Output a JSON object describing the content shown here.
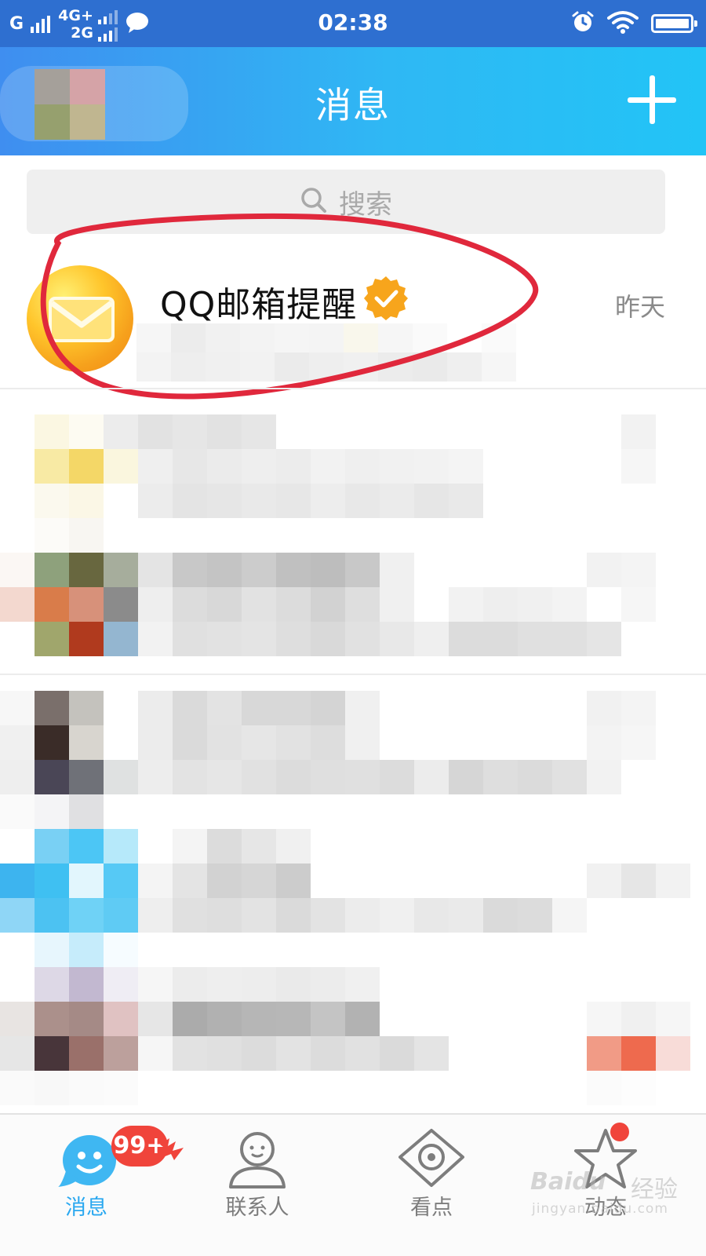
{
  "status_bar": {
    "network_1": "G",
    "network_2": "4G+",
    "network_3": "2G",
    "time": "02:38",
    "icons": [
      "signal-icon",
      "message-bubble-icon",
      "alarm-icon",
      "wifi-icon",
      "battery-icon"
    ]
  },
  "header": {
    "title": "消息",
    "add_icon": "plus-icon",
    "header_color": "#2fb8f4"
  },
  "search": {
    "label": "搜索",
    "icon": "search-icon"
  },
  "conversations": [
    {
      "name": "QQ邮箱提醒",
      "time": "昨天",
      "avatar_icon": "envelope-icon",
      "verified_icon": "verified-badge-icon",
      "annotation_color": "#e0283c"
    }
  ],
  "bottom_nav": {
    "items": [
      {
        "label": "消息",
        "icon": "chat-face-icon",
        "badge": "99+",
        "active": true
      },
      {
        "label": "联系人",
        "icon": "contacts-person-icon",
        "active": false
      },
      {
        "label": "看点",
        "icon": "eye-diamond-icon",
        "active": false
      },
      {
        "label": "动态",
        "icon": "star-icon",
        "active": false
      }
    ],
    "active_color": "#2aa8f0",
    "badge_color": "#f0443b"
  },
  "watermark": {
    "logo": "Baidu",
    "text": "经验",
    "url": "jingyan.baidu.com"
  }
}
